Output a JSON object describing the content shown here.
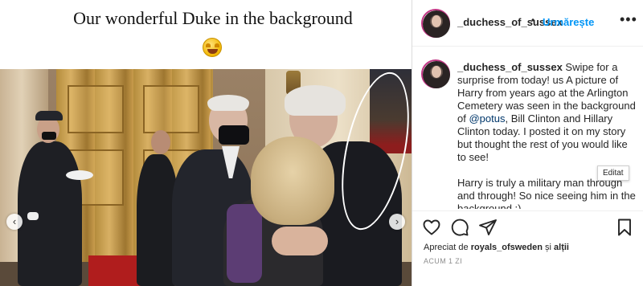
{
  "post": {
    "caption_title": "Our wonderful Duke in the background",
    "caption_emoji": "🤩"
  },
  "media": {
    "nav_prev": "‹",
    "nav_next": "›"
  },
  "header": {
    "username": "_duchess_of_sussex",
    "separator": "•",
    "follow_label": "Urmărește",
    "more_icon": "•••"
  },
  "comment": {
    "username": "_duchess_of_sussex",
    "text_part1": " Swipe for a surprise from today! us A picture of Harry from years ago at the Arlington Cemetery was seen in the background of ",
    "mention": "@potus",
    "text_part2": ", Bill Clinton and Hillary Clinton today. I posted it on my story but thought the rest of you would like to see!",
    "text_part3": "Harry is truly a military man through and through! So nice seeing him in the background :).",
    "edited_tooltip": "Editat"
  },
  "actions": {
    "icons": [
      "heart-icon",
      "comment-icon",
      "share-icon",
      "bookmark-icon"
    ]
  },
  "likes": {
    "prefix": "Apreciat de ",
    "user": "royals_ofsweden",
    "suffix": " și ",
    "others": "alții"
  },
  "timestamp": "ACUM 1 ZI",
  "colors": {
    "accent": "#0095f6",
    "mention": "#00376b",
    "muted": "#8e8e8e"
  }
}
